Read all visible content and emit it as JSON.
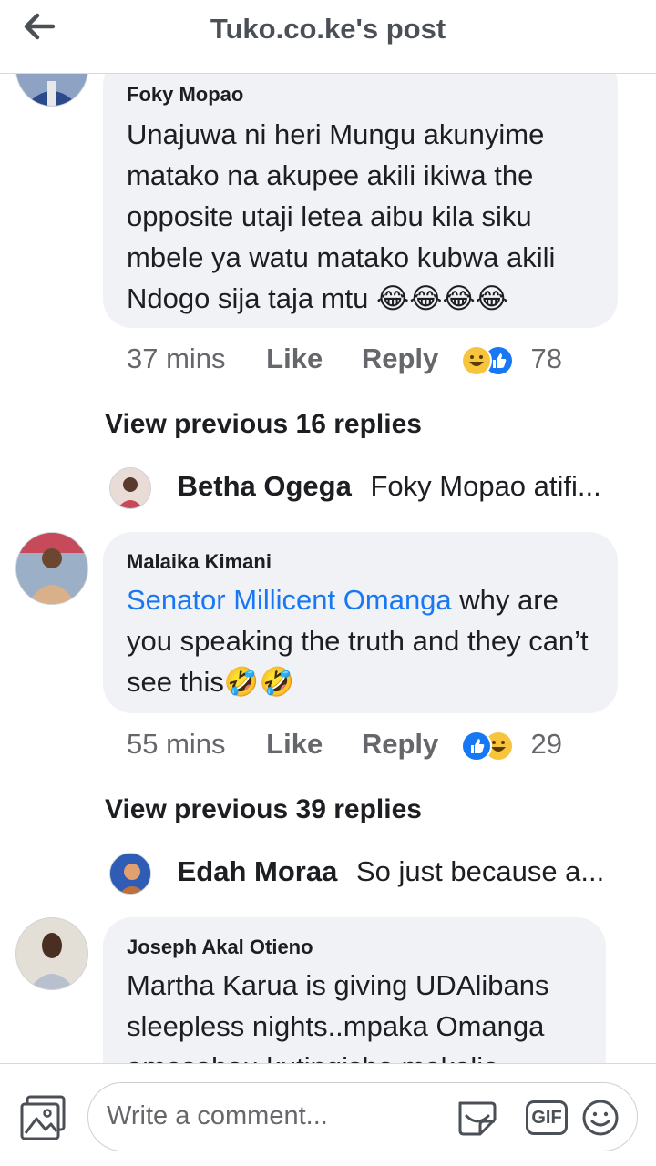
{
  "header": {
    "title": "Tuko.co.ke's post",
    "back_icon": "arrow-left-icon"
  },
  "comments": [
    {
      "name": "Foky Mopao",
      "text": "Unajuwa ni heri Mungu akunyime matako na akupee akili ikiwa the opposite utaji letea aibu kila siku mbele ya watu matako kubwa akili Ndogo sija taja mtu",
      "emoji": "😂😂😂😂",
      "time": "37 mins",
      "like_label": "Like",
      "reply_label": "Reply",
      "reaction_count": "78",
      "view_previous": "View previous 16 replies",
      "reply": {
        "name": "Betha Ogega",
        "text": "Foky Mopao atifi..."
      }
    },
    {
      "name": "Malaika Kimani",
      "mention": "Senator Millicent Omanga",
      "text_after": " why are you speaking the truth and they can’t see this",
      "emoji": "🤣🤣",
      "time": "55 mins",
      "like_label": "Like",
      "reply_label": "Reply",
      "reaction_count": "29",
      "view_previous": "View previous 39 replies",
      "reply": {
        "name": "Edah Moraa",
        "text": "So just because a..."
      }
    },
    {
      "name": "Joseph Akal Otieno",
      "text": "Martha Karua is giving UDAlibans sleepless nights..mpaka Omanga amesahau kutingisha makalio"
    }
  ],
  "composer": {
    "placeholder": "Write a comment...",
    "photo_icon": "photo-icon",
    "sticker_icon": "sticker-icon",
    "gif_label": "GIF",
    "emoji_icon": "emoji-icon"
  }
}
